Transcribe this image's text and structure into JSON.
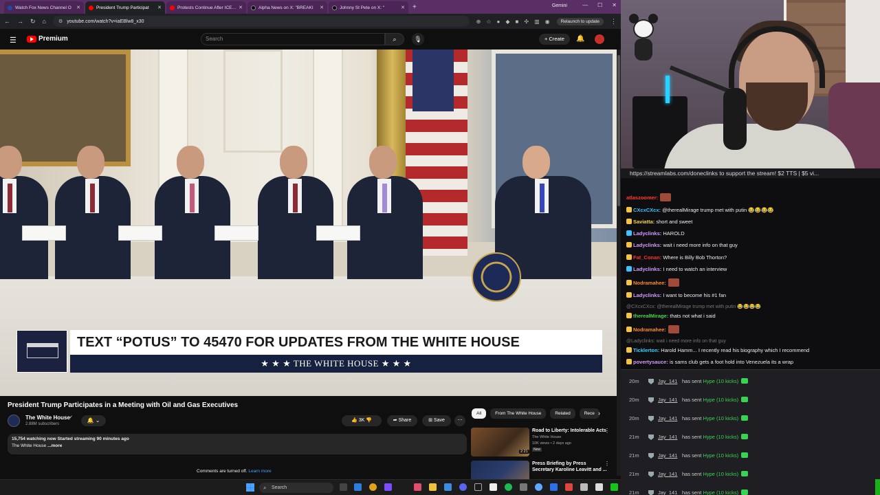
{
  "browser": {
    "tabs": [
      {
        "title": "Watch Fox News Channel O",
        "active": false
      },
      {
        "title": "President Trump Participat",
        "active": true
      },
      {
        "title": "Protests Continue After ICE M",
        "active": false
      },
      {
        "title": "Alpha News on X: \"BREAKI",
        "active": false
      },
      {
        "title": "Johnny St Pete on X: \"",
        "active": false
      }
    ],
    "extra_tab_label": "Gemini",
    "url": "youtube.com/watch?v=iaEBlw8_x30",
    "relaunch_label": "Relaunch to update"
  },
  "youtube": {
    "logo_text": "Premium",
    "search_placeholder": "Search",
    "create_label": "Create",
    "video": {
      "lower_third_top": "TEXT “POTUS” TO 45470 FOR UPDATES FROM THE WHITE HOUSE",
      "lower_third_bottom": "★ ★ ★   THE WHITE HOUSE   ★ ★ ★"
    },
    "title": "President Trump Participates in a Meeting with Oil and Gas Executives",
    "channel": {
      "name": "The White House",
      "subscribers": "2.88M subscribers"
    },
    "actions": {
      "likes": "3K",
      "share": "Share",
      "save": "Save"
    },
    "description": {
      "stats": "15,754 watching now  Started streaming 90 minutes ago",
      "text": "The White House",
      "more": " ...more"
    },
    "comments_off": "Comments are turned off.",
    "learn_more": "Learn more",
    "chips": [
      "All",
      "From The White House",
      "Related",
      "Rece"
    ],
    "recommendations": [
      {
        "title": "Road to Liberty: Intolerable Acts",
        "channel": "The White House",
        "meta": "10K views • 2 days ago",
        "badge": "New",
        "duration": "2:21"
      },
      {
        "title": "Press Briefing by Press Secretary Karoline Leavitt and ...",
        "channel": "",
        "meta": "",
        "badge": "",
        "duration": ""
      }
    ]
  },
  "taskbar": {
    "search_label": "Search"
  },
  "chat": {
    "donate_banner": "https://streamlabs.com/doneclinks to support the stream! $2 TTS | $5 vi...",
    "messages": [
      {
        "user": "atlaszoomer:",
        "text": "",
        "color": "#ff3b30",
        "emote": true,
        "reply": false
      },
      {
        "user": "CXcxCXcx:",
        "text": "@therealMirage trump met with putin 😂😂😂😂",
        "color": "#3cc3ff",
        "emote": false,
        "reply": false
      },
      {
        "user": "Saviatta:",
        "text": "short and sweet",
        "color": "#f5d442",
        "emote": false,
        "reply": false
      },
      {
        "user": "Ladyclinks:",
        "text": "HAROLD",
        "color": "#d39bff",
        "emote": false,
        "reply": false
      },
      {
        "user": "Ladyclinks:",
        "text": "wait i need more info on that guy",
        "color": "#d39bff",
        "emote": false,
        "reply": false
      },
      {
        "user": "Fat_Conan:",
        "text": "Where is Billy Bob Thorton?",
        "color": "#ff3030",
        "emote": false,
        "reply": false
      },
      {
        "user": "Ladyclinks:",
        "text": "I need to watch an interview",
        "color": "#d39bff",
        "emote": false,
        "reply": false
      },
      {
        "user": "Nodramahee:",
        "text": "",
        "color": "#ff8c2a",
        "emote": true,
        "reply": false
      },
      {
        "user": "Ladyclinks:",
        "text": "I want to become his #1 fan",
        "color": "#d39bff",
        "emote": false,
        "reply": false
      },
      {
        "user": "@CXcxCXcx: @therealMirage trump met with putin 😂😂😂😂",
        "text": "",
        "color": "#777777",
        "emote": false,
        "reply": true
      },
      {
        "user": "therealMirage:",
        "text": "thats not what i said",
        "color": "#4dd34d",
        "emote": false,
        "reply": false
      },
      {
        "user": "Nodramahee:",
        "text": "",
        "color": "#ff8c2a",
        "emote": true,
        "reply": false
      },
      {
        "user": "@Ladyclinks: wait i need more info on that guy",
        "text": "",
        "color": "#777777",
        "emote": false,
        "reply": true
      },
      {
        "user": "Ticklerton:",
        "text": "Harold Hamm... I recently read his biography which I recommend",
        "color": "#3cd3ff",
        "emote": false,
        "reply": false
      },
      {
        "user": "povertysauce:",
        "text": "is sams club gets a foot hold into Venezuela its a wrap",
        "color": "#d39bff",
        "emote": false,
        "reply": false
      }
    ],
    "events": [
      {
        "time": "20m",
        "user": "Jay_141",
        "action": "has sent",
        "hype": "Hype (10 kicks)"
      },
      {
        "time": "20m",
        "user": "Jay_141",
        "action": "has sent",
        "hype": "Hype (10 kicks)"
      },
      {
        "time": "20m",
        "user": "Jay_141",
        "action": "has sent",
        "hype": "Hype (10 kicks)"
      },
      {
        "time": "21m",
        "user": "Jay_141",
        "action": "has sent",
        "hype": "Hype (10 kicks)"
      },
      {
        "time": "21m",
        "user": "Jay_141",
        "action": "has sent",
        "hype": "Hype (10 kicks)"
      },
      {
        "time": "21m",
        "user": "Jay_141",
        "action": "has sent",
        "hype": "Hype (10 kicks)"
      },
      {
        "time": "21m",
        "user": "Jay_141",
        "action": "has sent",
        "hype": "Hype (10 kicks)"
      }
    ]
  }
}
